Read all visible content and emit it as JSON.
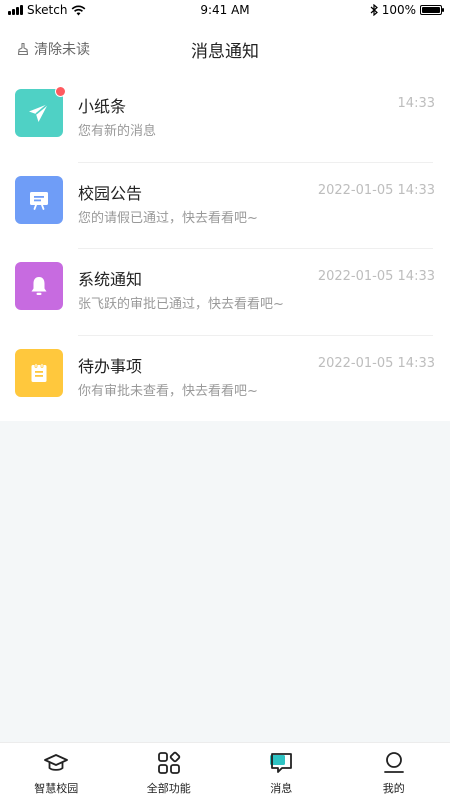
{
  "status_bar": {
    "carrier": "Sketch",
    "time": "9:41 AM",
    "battery": "100%",
    "battery_level": 1.0
  },
  "header": {
    "clear_unread_label": "清除未读",
    "title": "消息通知"
  },
  "messages": [
    {
      "title": "小纸条",
      "preview": "您有新的消息",
      "time": "14:33",
      "icon": "paper-plane-icon",
      "color": "#4fd1c5",
      "unread": true
    },
    {
      "title": "校园公告",
      "preview": "您的请假已通过，快去看看吧~",
      "time": "2022-01-05 14:33",
      "icon": "notice-board-icon",
      "color": "#6f9df7",
      "unread": false
    },
    {
      "title": "系统通知",
      "preview": "张飞跃的审批已通过，快去看看吧~",
      "time": "2022-01-05 14:33",
      "icon": "bell-icon",
      "color": "#c76be0",
      "unread": false
    },
    {
      "title": "待办事项",
      "preview": "你有审批未查看，快去看看吧~",
      "time": "2022-01-05 14:33",
      "icon": "clipboard-icon",
      "color": "#ffc83d",
      "unread": false
    }
  ],
  "tabs": [
    {
      "label": "智慧校园",
      "icon": "graduation-cap-icon",
      "active": false
    },
    {
      "label": "全部功能",
      "icon": "apps-grid-icon",
      "active": false
    },
    {
      "label": "消息",
      "icon": "chat-icon",
      "active": true
    },
    {
      "label": "我的",
      "icon": "user-icon",
      "active": false
    }
  ],
  "colors": {
    "accent": "#2ec4c4",
    "unread_dot": "#ff5a5f",
    "page_background": "#f4f7f8"
  }
}
